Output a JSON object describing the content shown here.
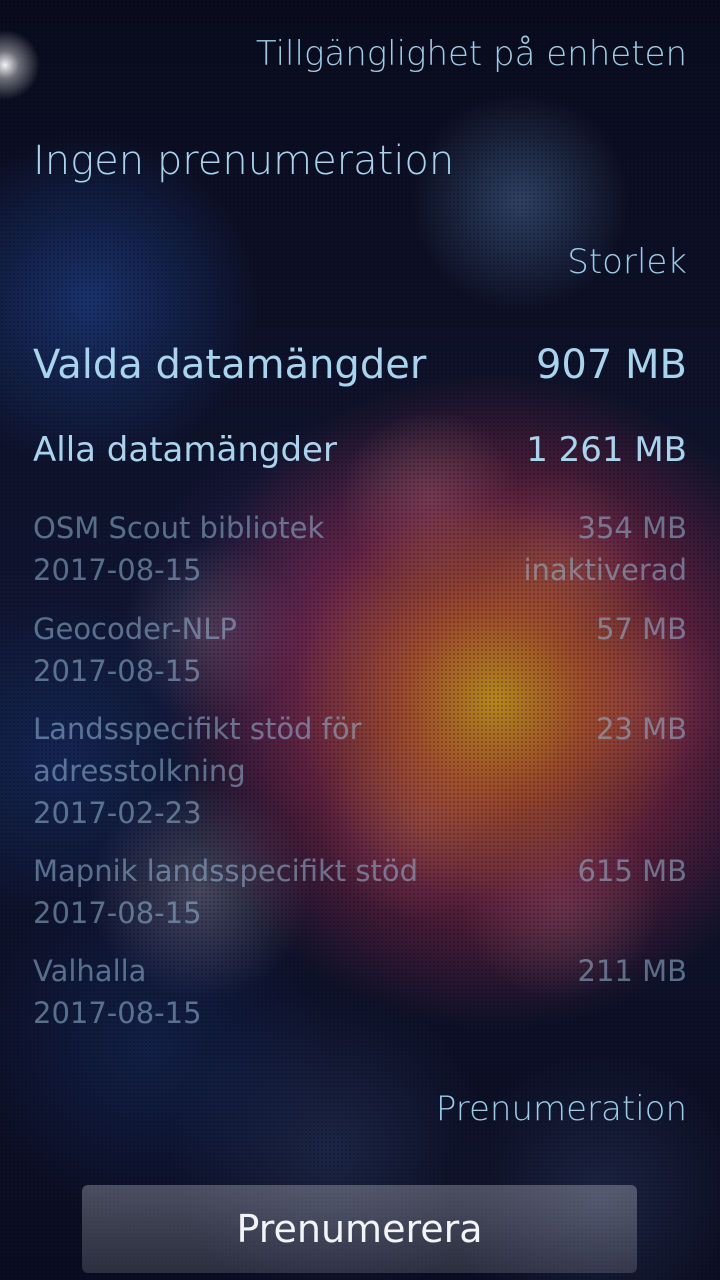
{
  "header": {
    "title": "Tillgänglighet på enheten"
  },
  "subscription_status": "Ingen prenumeration",
  "size_section": {
    "label": "Storlek"
  },
  "summary": [
    {
      "label": "Valda datamängder",
      "value": "907 MB"
    },
    {
      "label": "Alla datamängder",
      "value": "1 261 MB"
    }
  ],
  "datasets": [
    {
      "name": "OSM Scout bibliotek",
      "date": "2017-08-15",
      "size": "354 MB",
      "status": "inaktiverad"
    },
    {
      "name": "Geocoder-NLP",
      "date": "2017-08-15",
      "size": "57 MB",
      "status": ""
    },
    {
      "name": "Landsspecifikt stöd för adresstolkning",
      "date": "2017-02-23",
      "size": "23 MB",
      "status": ""
    },
    {
      "name": "Mapnik landsspecifikt stöd",
      "date": "2017-08-15",
      "size": "615 MB",
      "status": ""
    },
    {
      "name": "Valhalla",
      "date": "2017-08-15",
      "size": "211 MB",
      "status": ""
    }
  ],
  "subscription_section": {
    "label": "Prenumeration"
  },
  "subscribe_button": {
    "label": "Prenumerera"
  }
}
